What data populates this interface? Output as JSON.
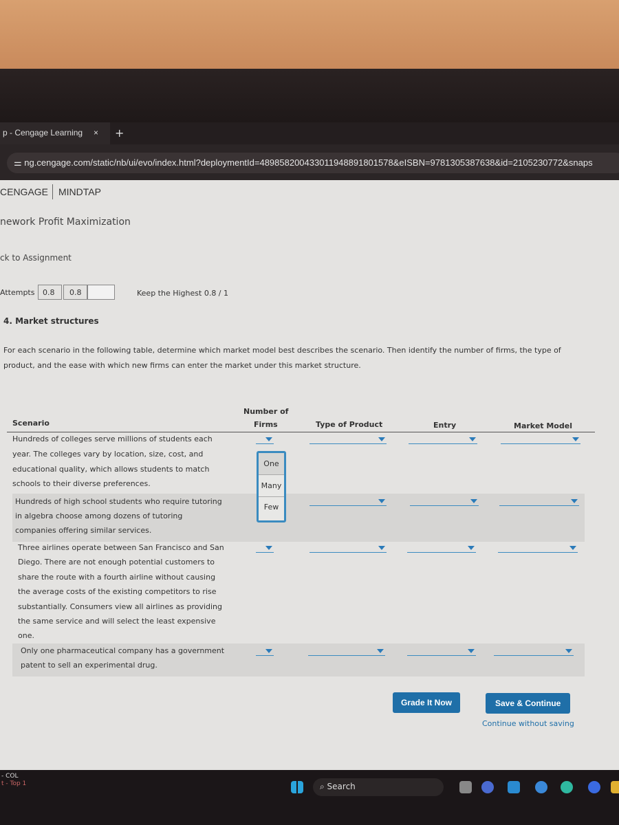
{
  "browser": {
    "tab_title": "p - Cengage Learning",
    "tab_close": "×",
    "new_tab": "+",
    "url": "ng.cengage.com/static/nb/ui/evo/index.html?deploymentId=489858200433011948891801578&eISBN=9781305387638&id=2105230772&snaps"
  },
  "header": {
    "brand": "CENGAGE",
    "product": "MINDTAP",
    "assignment_title": "nework Profit Maximization",
    "back_link": "ck to Assignment"
  },
  "attempts": {
    "label": "Attempts",
    "values": [
      "0.8",
      "0.8",
      ""
    ],
    "keep": "Keep the Highest 0.8 / 1"
  },
  "question": {
    "title": "4. Market structures",
    "prompt_line1": "For each scenario in the following table, determine which market model best describes the scenario. Then identify the number of firms, the type of",
    "prompt_line2": "product, and the ease with which new firms can enter the market under this market structure."
  },
  "table": {
    "headers": {
      "scenario": "Scenario",
      "firms_1": "Number of",
      "firms_2": "Firms",
      "product": "Type of Product",
      "entry": "Entry",
      "model": "Market Model"
    },
    "rows": [
      {
        "lines": [
          "Hundreds of colleges serve millions of students each",
          "year. The colleges vary by location, size, cost, and",
          "educational quality, which allows students to match",
          "schools to their diverse preferences."
        ]
      },
      {
        "lines": [
          "Hundreds of high school students who require tutoring",
          "in algebra choose among dozens of tutoring",
          "companies offering similar services."
        ]
      },
      {
        "lines": [
          "Three airlines operate between San Francisco and San",
          "Diego. There are not enough potential customers to",
          "share the route with a fourth airline without causing",
          "the average costs of the existing competitors to rise",
          "substantially. Consumers view all airlines as providing",
          "the same service and will select the least expensive",
          "one."
        ]
      },
      {
        "lines": [
          "Only one pharmaceutical company has a government",
          "patent to sell an experimental drug."
        ]
      }
    ],
    "open_dropdown_options": [
      "One",
      "Many",
      "Few"
    ]
  },
  "actions": {
    "grade": "Grade It Now",
    "save": "Save & Continue",
    "continue": "Continue without saving"
  },
  "taskbar": {
    "left_line1": "- COL",
    "left_line2": "t - Top 1",
    "search": "Search"
  }
}
